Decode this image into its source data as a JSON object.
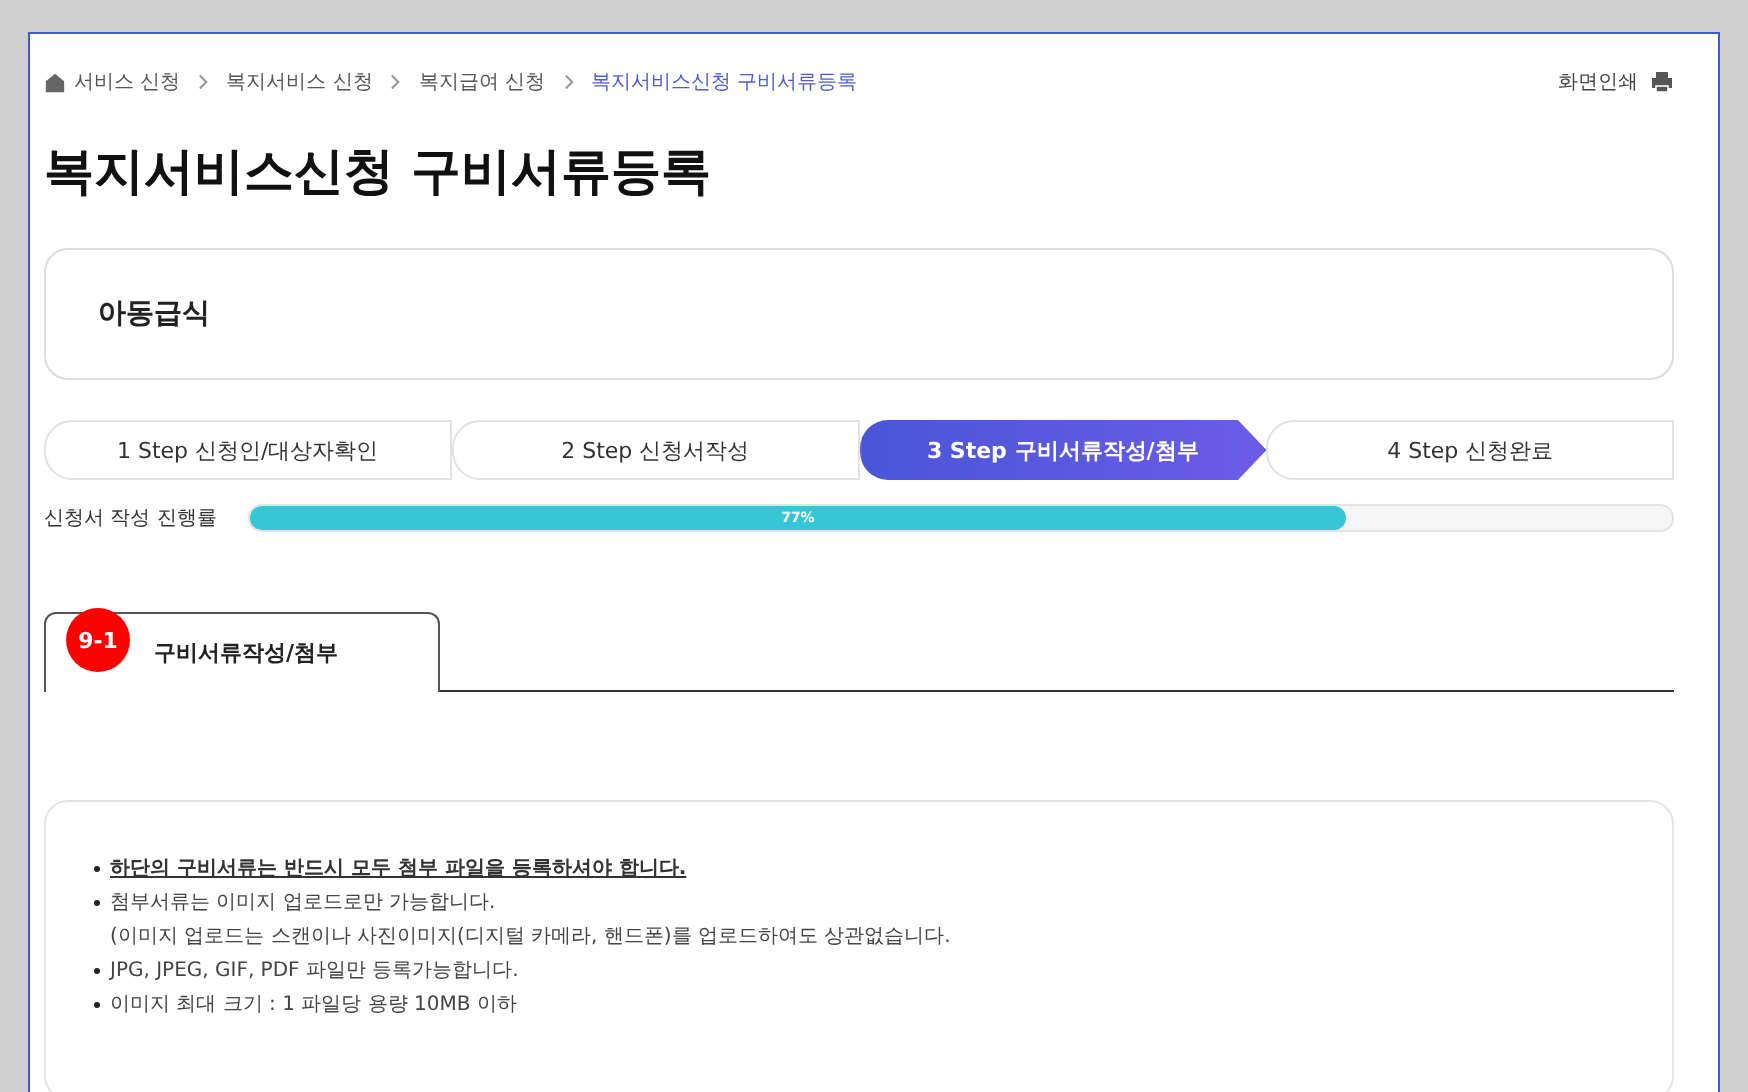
{
  "breadcrumb": [
    {
      "label": "서비스 신청",
      "current": false
    },
    {
      "label": "복지서비스 신청",
      "current": false
    },
    {
      "label": "복지급여 신청",
      "current": false
    },
    {
      "label": "복지서비스신청 구비서류등록",
      "current": true
    }
  ],
  "print_button": "화면인쇄",
  "title": "복지서비스신청 구비서류등록",
  "service_name": "아동급식",
  "steps": [
    {
      "label": "1 Step 신청인/대상자확인",
      "selected": false
    },
    {
      "label": "2 Step 신청서작성",
      "selected": false
    },
    {
      "label": "3 Step 구비서류작성/첨부",
      "selected": true
    },
    {
      "label": "4 Step 신청완료",
      "selected": false
    }
  ],
  "progress": {
    "label": "신청서 작성 진행률",
    "level": 0.77,
    "reading": "77%"
  },
  "tab": {
    "badge": "9-1",
    "label": "구비서류작성/첨부"
  },
  "notices": [
    {
      "text": "하단의 구비서류는 반드시 모두 첨부 파일을 등록하셔야 합니다.",
      "emphasis": true
    },
    {
      "text": "첨부서류는 이미지 업로드로만 가능합니다.",
      "emphasis": false,
      "sub": "(이미지 업로드는 스캔이나 사진이미지(디지털 카메라, 핸드폰)를 업로드하여도 상관없습니다."
    },
    {
      "text": "JPG, JPEG, GIF, PDF 파일만 등록가능합니다.",
      "emphasis": false
    },
    {
      "text": "이미지 최대 크기 : 1 파일당 용량 10MB 이하",
      "emphasis": false
    }
  ]
}
